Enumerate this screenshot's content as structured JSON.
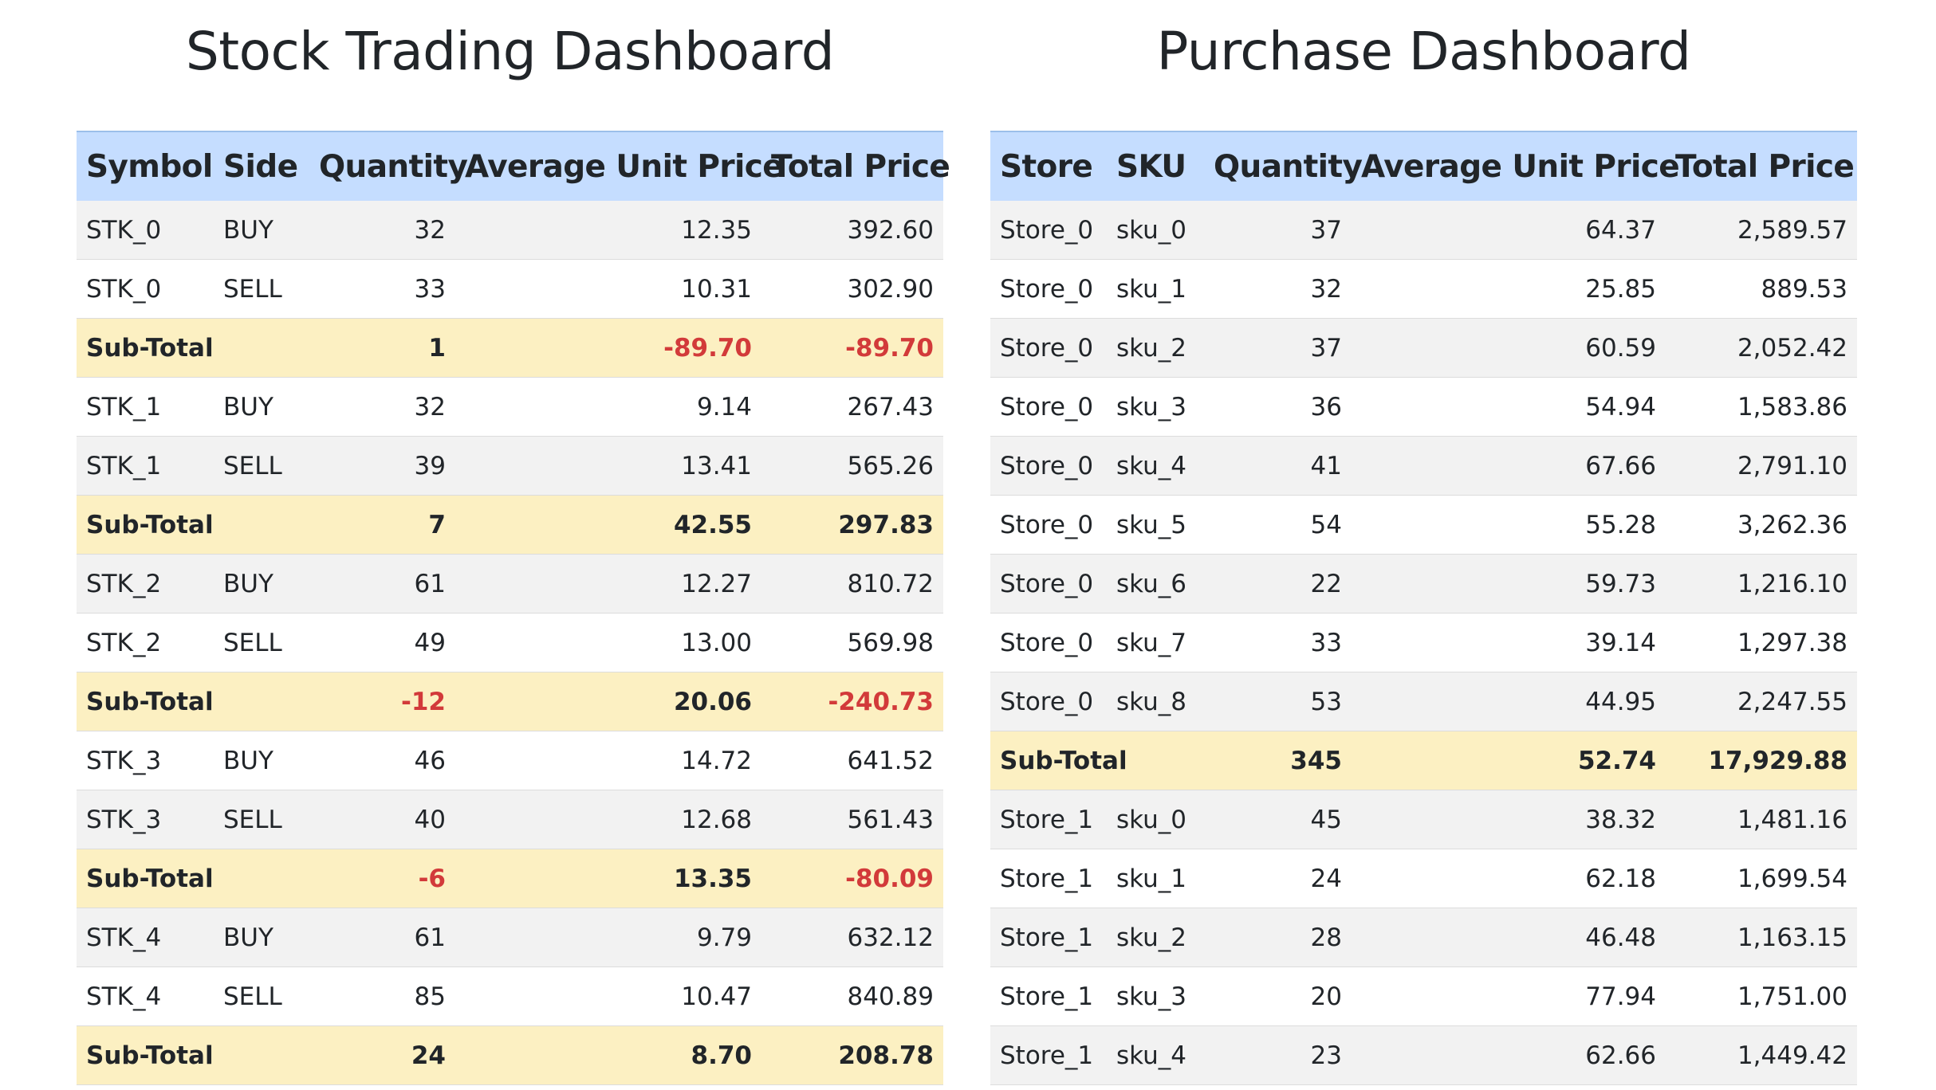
{
  "stock": {
    "title": "Stock Trading Dashboard",
    "headers": [
      "Symbol",
      "Side",
      "Quantity",
      "Average Unit Price",
      "Total Price"
    ],
    "rows": [
      {
        "type": "data",
        "cells": [
          "STK_0",
          "BUY",
          "32",
          "12.35",
          "392.60"
        ]
      },
      {
        "type": "data",
        "cells": [
          "STK_0",
          "SELL",
          "33",
          "10.31",
          "302.90"
        ]
      },
      {
        "type": "subtotal",
        "cells": [
          "Sub-Total",
          "",
          "1",
          "-89.70",
          "-89.70"
        ]
      },
      {
        "type": "data",
        "cells": [
          "STK_1",
          "BUY",
          "32",
          "9.14",
          "267.43"
        ]
      },
      {
        "type": "data",
        "cells": [
          "STK_1",
          "SELL",
          "39",
          "13.41",
          "565.26"
        ]
      },
      {
        "type": "subtotal",
        "cells": [
          "Sub-Total",
          "",
          "7",
          "42.55",
          "297.83"
        ]
      },
      {
        "type": "data",
        "cells": [
          "STK_2",
          "BUY",
          "61",
          "12.27",
          "810.72"
        ]
      },
      {
        "type": "data",
        "cells": [
          "STK_2",
          "SELL",
          "49",
          "13.00",
          "569.98"
        ]
      },
      {
        "type": "subtotal",
        "cells": [
          "Sub-Total",
          "",
          "-12",
          "20.06",
          "-240.73"
        ]
      },
      {
        "type": "data",
        "cells": [
          "STK_3",
          "BUY",
          "46",
          "14.72",
          "641.52"
        ]
      },
      {
        "type": "data",
        "cells": [
          "STK_3",
          "SELL",
          "40",
          "12.68",
          "561.43"
        ]
      },
      {
        "type": "subtotal",
        "cells": [
          "Sub-Total",
          "",
          "-6",
          "13.35",
          "-80.09"
        ]
      },
      {
        "type": "data",
        "cells": [
          "STK_4",
          "BUY",
          "61",
          "9.79",
          "632.12"
        ]
      },
      {
        "type": "data",
        "cells": [
          "STK_4",
          "SELL",
          "85",
          "10.47",
          "840.89"
        ]
      },
      {
        "type": "subtotal",
        "cells": [
          "Sub-Total",
          "",
          "24",
          "8.70",
          "208.78"
        ]
      }
    ]
  },
  "purchase": {
    "title": "Purchase Dashboard",
    "headers": [
      "Store",
      "SKU",
      "Quantity",
      "Average Unit Price",
      "Total Price"
    ],
    "rows": [
      {
        "type": "data",
        "cells": [
          "Store_0",
          "sku_0",
          "37",
          "64.37",
          "2,589.57"
        ]
      },
      {
        "type": "data",
        "cells": [
          "Store_0",
          "sku_1",
          "32",
          "25.85",
          "889.53"
        ]
      },
      {
        "type": "data",
        "cells": [
          "Store_0",
          "sku_2",
          "37",
          "60.59",
          "2,052.42"
        ]
      },
      {
        "type": "data",
        "cells": [
          "Store_0",
          "sku_3",
          "36",
          "54.94",
          "1,583.86"
        ]
      },
      {
        "type": "data",
        "cells": [
          "Store_0",
          "sku_4",
          "41",
          "67.66",
          "2,791.10"
        ]
      },
      {
        "type": "data",
        "cells": [
          "Store_0",
          "sku_5",
          "54",
          "55.28",
          "3,262.36"
        ]
      },
      {
        "type": "data",
        "cells": [
          "Store_0",
          "sku_6",
          "22",
          "59.73",
          "1,216.10"
        ]
      },
      {
        "type": "data",
        "cells": [
          "Store_0",
          "sku_7",
          "33",
          "39.14",
          "1,297.38"
        ]
      },
      {
        "type": "data",
        "cells": [
          "Store_0",
          "sku_8",
          "53",
          "44.95",
          "2,247.55"
        ]
      },
      {
        "type": "subtotal",
        "cells": [
          "Sub-Total",
          "",
          "345",
          "52.74",
          "17,929.88"
        ]
      },
      {
        "type": "data",
        "cells": [
          "Store_1",
          "sku_0",
          "45",
          "38.32",
          "1,481.16"
        ]
      },
      {
        "type": "data",
        "cells": [
          "Store_1",
          "sku_1",
          "24",
          "62.18",
          "1,699.54"
        ]
      },
      {
        "type": "data",
        "cells": [
          "Store_1",
          "sku_2",
          "28",
          "46.48",
          "1,163.15"
        ]
      },
      {
        "type": "data",
        "cells": [
          "Store_1",
          "sku_3",
          "20",
          "77.94",
          "1,751.00"
        ]
      },
      {
        "type": "data",
        "cells": [
          "Store_1",
          "sku_4",
          "23",
          "62.66",
          "1,449.42"
        ]
      }
    ]
  },
  "colors": {
    "header_bg": "#c5ddff",
    "row_alt_bg": "#f2f2f2",
    "subtotal_bg": "#fcf0c2",
    "negative_text": "#d23a3a"
  }
}
